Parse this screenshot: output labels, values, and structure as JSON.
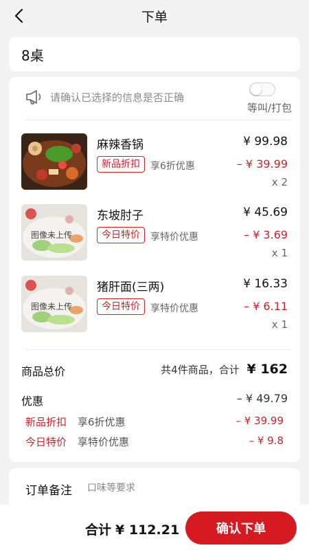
{
  "header": {
    "title": "下单",
    "back_icon": "chevron-left-icon"
  },
  "table": {
    "label": "8桌"
  },
  "notice": {
    "icon": "megaphone-icon",
    "text": "请确认已选择的信息是否正确",
    "toggle_label": "等叫/打包",
    "toggle_on": false
  },
  "items": [
    {
      "name": "麻辣香锅",
      "price": "¥ 99.98",
      "badge": "新品折扣",
      "promo": "享6折优惠",
      "discount": "– ¥ 39.99",
      "qty": "x 2",
      "image_placeholder": ""
    },
    {
      "name": "东坡肘子",
      "price": "¥ 45.69",
      "badge": "今日特价",
      "promo": "享特价优惠",
      "discount": "– ¥ 3.69",
      "qty": "x 1",
      "image_placeholder": "图像未上传"
    },
    {
      "name": "猪肝面(三两)",
      "price": "¥ 16.33",
      "badge": "今日特价",
      "promo": "享特价优惠",
      "discount": "– ¥ 6.11",
      "qty": "x 1",
      "image_placeholder": "图像未上传"
    }
  ],
  "summary": {
    "total_label": "商品总价",
    "count_text": "共4件商品，合计",
    "total_value": "¥ 162",
    "discount_label": "优惠",
    "discount_value": "– ¥ 49.79",
    "promos": [
      {
        "label": "新品折扣",
        "desc": "享6折优惠",
        "value": "– ¥ 39.99"
      },
      {
        "label": "今日特价",
        "desc": "享特价优惠",
        "value": "– ¥ 9.8"
      }
    ]
  },
  "remark": {
    "label": "订单备注",
    "placeholder": "口味等要求"
  },
  "footer": {
    "total_label": "合计",
    "total_value": "¥ 112.21",
    "confirm_label": "确认下单"
  },
  "colors": {
    "accent": "#d61a22",
    "background": "#f2f2f2"
  }
}
